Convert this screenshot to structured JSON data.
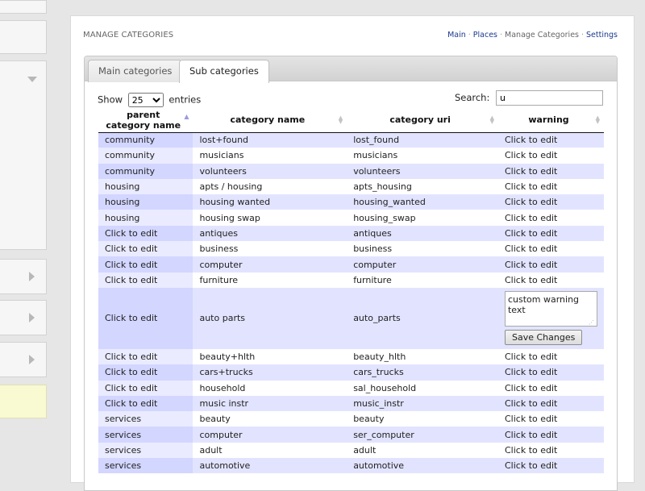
{
  "header": {
    "title": "MANAGE CATEGORIES",
    "breadcrumb": [
      {
        "label": "Main",
        "link": true
      },
      {
        "label": "Places",
        "link": true
      },
      {
        "label": "Manage Categories",
        "link": false
      },
      {
        "label": "Settings",
        "link": true
      }
    ],
    "separator": "·"
  },
  "tabs": [
    {
      "label": "Main categories",
      "active": false
    },
    {
      "label": "Sub categories",
      "active": true
    }
  ],
  "controls": {
    "show_label": "Show",
    "entries_value": "25",
    "entries_label": "entries",
    "search_label": "Search:",
    "search_value": "u"
  },
  "table": {
    "columns": [
      "parent category name",
      "category name",
      "category uri",
      "warning"
    ],
    "sorted_column": 0,
    "sort_direction": "asc",
    "rows": [
      {
        "parent": "community",
        "name": "lost+found",
        "uri": "lost_found",
        "warning": "Click to edit"
      },
      {
        "parent": "community",
        "name": "musicians",
        "uri": "musicians",
        "warning": "Click to edit"
      },
      {
        "parent": "community",
        "name": "volunteers",
        "uri": "volunteers",
        "warning": "Click to edit"
      },
      {
        "parent": "housing",
        "name": "apts / housing",
        "uri": "apts_housing",
        "warning": "Click to edit"
      },
      {
        "parent": "housing",
        "name": "housing wanted",
        "uri": "housing_wanted",
        "warning": "Click to edit"
      },
      {
        "parent": "housing",
        "name": "housing swap",
        "uri": "housing_swap",
        "warning": "Click to edit"
      },
      {
        "parent": "Click to edit",
        "name": "antiques",
        "uri": "antiques",
        "warning": "Click to edit"
      },
      {
        "parent": "Click to edit",
        "name": "business",
        "uri": "business",
        "warning": "Click to edit"
      },
      {
        "parent": "Click to edit",
        "name": "computer",
        "uri": "computer",
        "warning": "Click to edit"
      },
      {
        "parent": "Click to edit",
        "name": "furniture",
        "uri": "furniture",
        "warning": "Click to edit"
      },
      {
        "parent": "Click to edit",
        "name": "auto parts",
        "uri": "auto_parts",
        "editing": true,
        "warning_edit_value": "custom warning text",
        "save_label": "Save Changes"
      },
      {
        "parent": "Click to edit",
        "name": "beauty+hlth",
        "uri": "beauty_hlth",
        "warning": "Click to edit"
      },
      {
        "parent": "Click to edit",
        "name": "cars+trucks",
        "uri": "cars_trucks",
        "warning": "Click to edit"
      },
      {
        "parent": "Click to edit",
        "name": "household",
        "uri": "sal_household",
        "warning": "Click to edit"
      },
      {
        "parent": "Click to edit",
        "name": "music instr",
        "uri": "music_instr",
        "warning": "Click to edit"
      },
      {
        "parent": "services",
        "name": "beauty",
        "uri": "beauty",
        "warning": "Click to edit"
      },
      {
        "parent": "services",
        "name": "computer",
        "uri": "ser_computer",
        "warning": "Click to edit"
      },
      {
        "parent": "services",
        "name": "adult",
        "uri": "adult",
        "warning": "Click to edit"
      },
      {
        "parent": "services",
        "name": "automotive",
        "uri": "automotive",
        "warning": "Click to edit"
      }
    ]
  },
  "colors": {
    "odd_row": "#e2e4ff",
    "sorted_odd": "#d3d6ff",
    "link": "#1a3a8f",
    "sidebar_note": "#fafad2"
  },
  "icons": {
    "sort_asc": "sort-ascending-icon",
    "sort_both": "sort-both-icon",
    "collapse": "chevron-down-icon",
    "expand": "chevron-right-icon"
  }
}
